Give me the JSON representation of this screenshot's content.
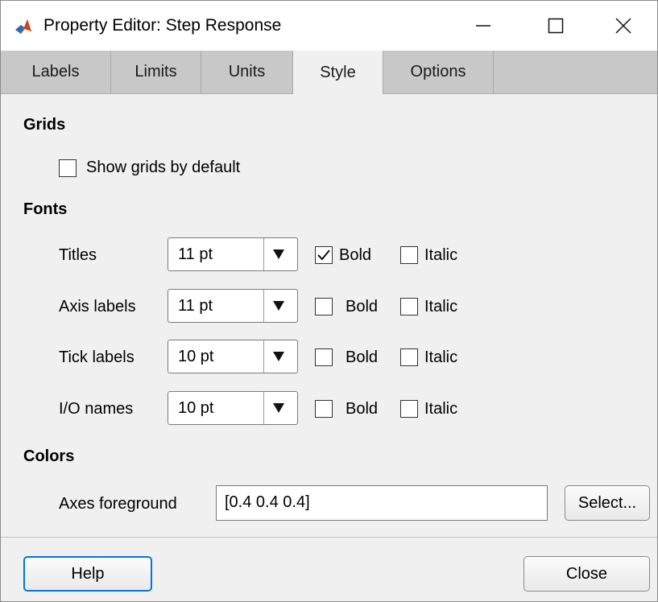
{
  "window": {
    "title": "Property Editor: Step Response"
  },
  "tabs": [
    {
      "label": "Labels"
    },
    {
      "label": "Limits"
    },
    {
      "label": "Units"
    },
    {
      "label": "Style",
      "active": true
    },
    {
      "label": "Options"
    }
  ],
  "grids": {
    "heading": "Grids",
    "show_grids_label": "Show grids by default",
    "show_grids_checked": false
  },
  "fonts": {
    "heading": "Fonts",
    "rows": [
      {
        "label": "Titles",
        "size": "11 pt",
        "bold_label": "Bold",
        "bold": true,
        "italic_label": "Italic",
        "italic": false
      },
      {
        "label": "Axis labels",
        "size": "11 pt",
        "bold_label": "Bold",
        "bold": false,
        "italic_label": "Italic",
        "italic": false
      },
      {
        "label": "Tick labels",
        "size": "10 pt",
        "bold_label": "Bold",
        "bold": false,
        "italic_label": "Italic",
        "italic": false
      },
      {
        "label": "I/O names",
        "size": "10 pt",
        "bold_label": "Bold",
        "bold": false,
        "italic_label": "Italic",
        "italic": false
      }
    ]
  },
  "colors": {
    "heading": "Colors",
    "axes_foreground_label": "Axes foreground",
    "axes_foreground_value": "[0.4 0.4 0.4]",
    "select_button": "Select..."
  },
  "footer": {
    "help_button": "Help",
    "close_button": "Close"
  },
  "theme": {
    "window_bg": "#f0f0f0",
    "tabstrip_bg": "#c8c8c8",
    "focus_border": "#0078d7"
  }
}
